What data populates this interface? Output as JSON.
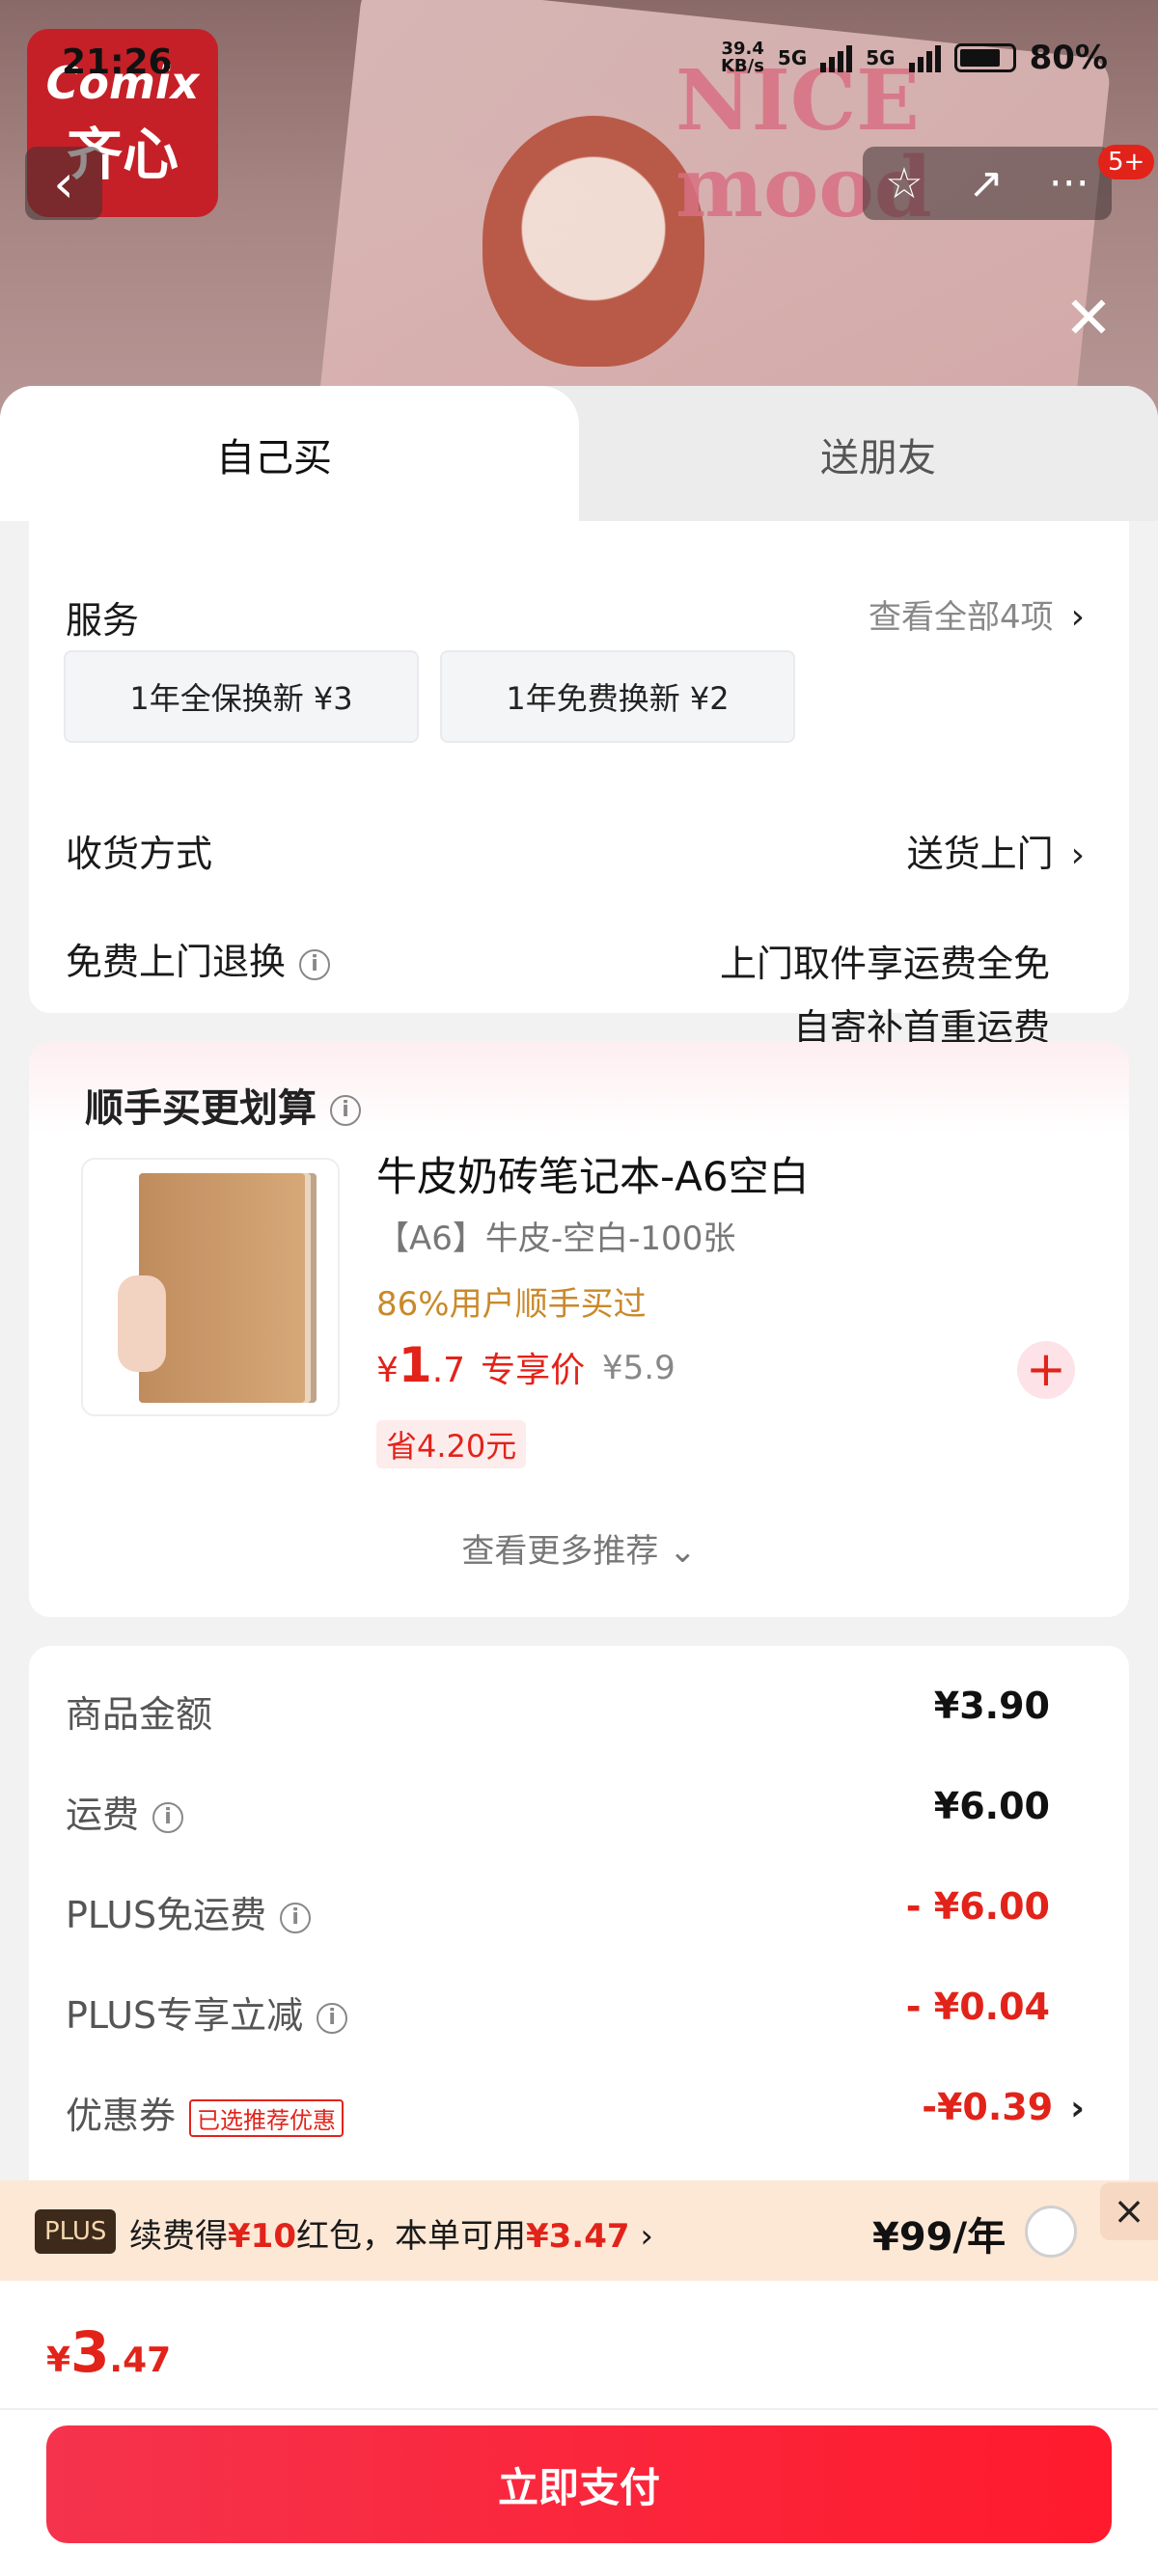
{
  "status_bar": {
    "time": "21:26",
    "speed": "39.4\nKB/s",
    "net1": "5G",
    "net2": "5G",
    "battery": "80%"
  },
  "brand": {
    "line1": "Comix",
    "line2": "齐心"
  },
  "hero": {
    "book_title": "NICE\nmood"
  },
  "nav": {
    "back_icon": "‹",
    "star_icon": "☆",
    "share_icon": "↗",
    "more_icon": "···",
    "badge": "5+"
  },
  "close_icon": "✕",
  "tabs": [
    {
      "label": "自己买",
      "active": true
    },
    {
      "label": "送朋友",
      "active": false
    }
  ],
  "service": {
    "label": "服务",
    "view_all": "查看全部4项",
    "options": [
      {
        "label": "1年全保换新 ¥3"
      },
      {
        "label": "1年免费换新 ¥2"
      }
    ]
  },
  "delivery": {
    "label": "收货方式",
    "value": "送货上门"
  },
  "free_return": {
    "label": "免费上门退换",
    "line1": "上门取件享运费全免",
    "line2": "自寄补首重运费"
  },
  "addon": {
    "title": "顺手买更划算",
    "product": {
      "name": "牛皮奶砖笔记本-A6空白",
      "spec": "【A6】牛皮-空白-100张",
      "bought": "86%用户顺手买过",
      "price_symbol": "¥",
      "price_int": "1",
      "price_dec": ".7",
      "price_tag": "专享价",
      "original_price": "¥5.9",
      "save": "省4.20元"
    },
    "more": "查看更多推荐 ⌄"
  },
  "fees": [
    {
      "label": "商品金额",
      "value": "¥3.90",
      "info": false,
      "red": false
    },
    {
      "label": "运费",
      "value": "¥6.00",
      "info": true,
      "red": false
    },
    {
      "label": "PLUS免运费",
      "value": "- ¥6.00",
      "info": true,
      "red": true
    },
    {
      "label": "PLUS专享立减",
      "value": "- ¥0.04",
      "info": true,
      "red": true
    },
    {
      "label": "优惠券",
      "value": "-¥0.39",
      "info": false,
      "red": true,
      "tag": "已选推荐优惠"
    }
  ],
  "plus_bar": {
    "tag": "PLUS",
    "text_a": "续费得",
    "text_b": "¥10",
    "text_c": "红包，本单可用",
    "text_d": "¥3.47",
    "text_e": " ›",
    "price": "¥99/年"
  },
  "total": {
    "symbol": "¥",
    "int": "3",
    "dec": ".47"
  },
  "pay_button": "立即支付",
  "colors": {
    "accent": "#e2231a",
    "pay_gradient_start": "#f5334c",
    "pay_gradient_end": "#ff1a2d",
    "plus_bg": "#fde8d6"
  }
}
